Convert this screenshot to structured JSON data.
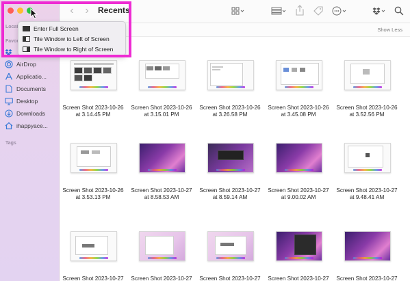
{
  "window": {
    "title": "Recents"
  },
  "sidebar": {
    "locations_label": "Locat",
    "favorites_label": "Favor",
    "tags_label": "Tags",
    "items": [
      {
        "label": "AirDrop",
        "icon": "airdrop-icon"
      },
      {
        "label": "Applicatio...",
        "icon": "applications-icon"
      },
      {
        "label": "Documents",
        "icon": "document-icon"
      },
      {
        "label": "Desktop",
        "icon": "desktop-icon"
      },
      {
        "label": "Downloads",
        "icon": "download-icon"
      },
      {
        "label": "ihappyace...",
        "icon": "home-icon"
      }
    ]
  },
  "toolbar": {
    "back": "‹",
    "forward": "›",
    "icons": [
      "grid-view-icon",
      "group-icon",
      "share-icon",
      "tag-icon",
      "more-icon",
      "dropbox-icon",
      "search-icon"
    ]
  },
  "header": {
    "show_less": "Show Less"
  },
  "menu": {
    "items": [
      {
        "label": "Enter Full Screen",
        "icon": "full-screen-icon"
      },
      {
        "label": "Tile Window to Left of Screen",
        "icon": "tile-left-icon"
      },
      {
        "label": "Tile Window to Right of Screen",
        "icon": "tile-right-icon"
      }
    ]
  },
  "files": [
    {
      "line1": "Screen Shot 2023-10-26",
      "line2": "at 3.14.45 PM"
    },
    {
      "line1": "Screen Shot 2023-10-26",
      "line2": "at 3.15.01 PM"
    },
    {
      "line1": "Screen Shot 2023-10-26",
      "line2": "at 3.26.58 PM"
    },
    {
      "line1": "Screen Shot 2023-10-26",
      "line2": "at 3.45.08 PM"
    },
    {
      "line1": "Screen Shot 2023-10-26",
      "line2": "at 3.52.56 PM"
    },
    {
      "line1": "Screen Shot 2023-10-26",
      "line2": "at 3.53.13 PM"
    },
    {
      "line1": "Screen Shot 2023-10-27",
      "line2": "at 8.58.53 AM"
    },
    {
      "line1": "Screen Shot 2023-10-27",
      "line2": "at 8.59.14 AM"
    },
    {
      "line1": "Screen Shot 2023-10-27",
      "line2": "at 9.00.02 AM"
    },
    {
      "line1": "Screen Shot 2023-10-27",
      "line2": "at 9.48.41 AM"
    },
    {
      "line1": "Screen Shot 2023-10-27",
      "line2": ""
    },
    {
      "line1": "Screen Shot 2023-10-27",
      "line2": ""
    },
    {
      "line1": "Screen Shot 2023-10-27",
      "line2": ""
    },
    {
      "line1": "Screen Shot 2023-10-27",
      "line2": ""
    },
    {
      "line1": "Screen Shot 2023-10-27",
      "line2": ""
    }
  ],
  "colors": {
    "highlight": "#ee2bd3",
    "accent": "#4a7bd9"
  }
}
